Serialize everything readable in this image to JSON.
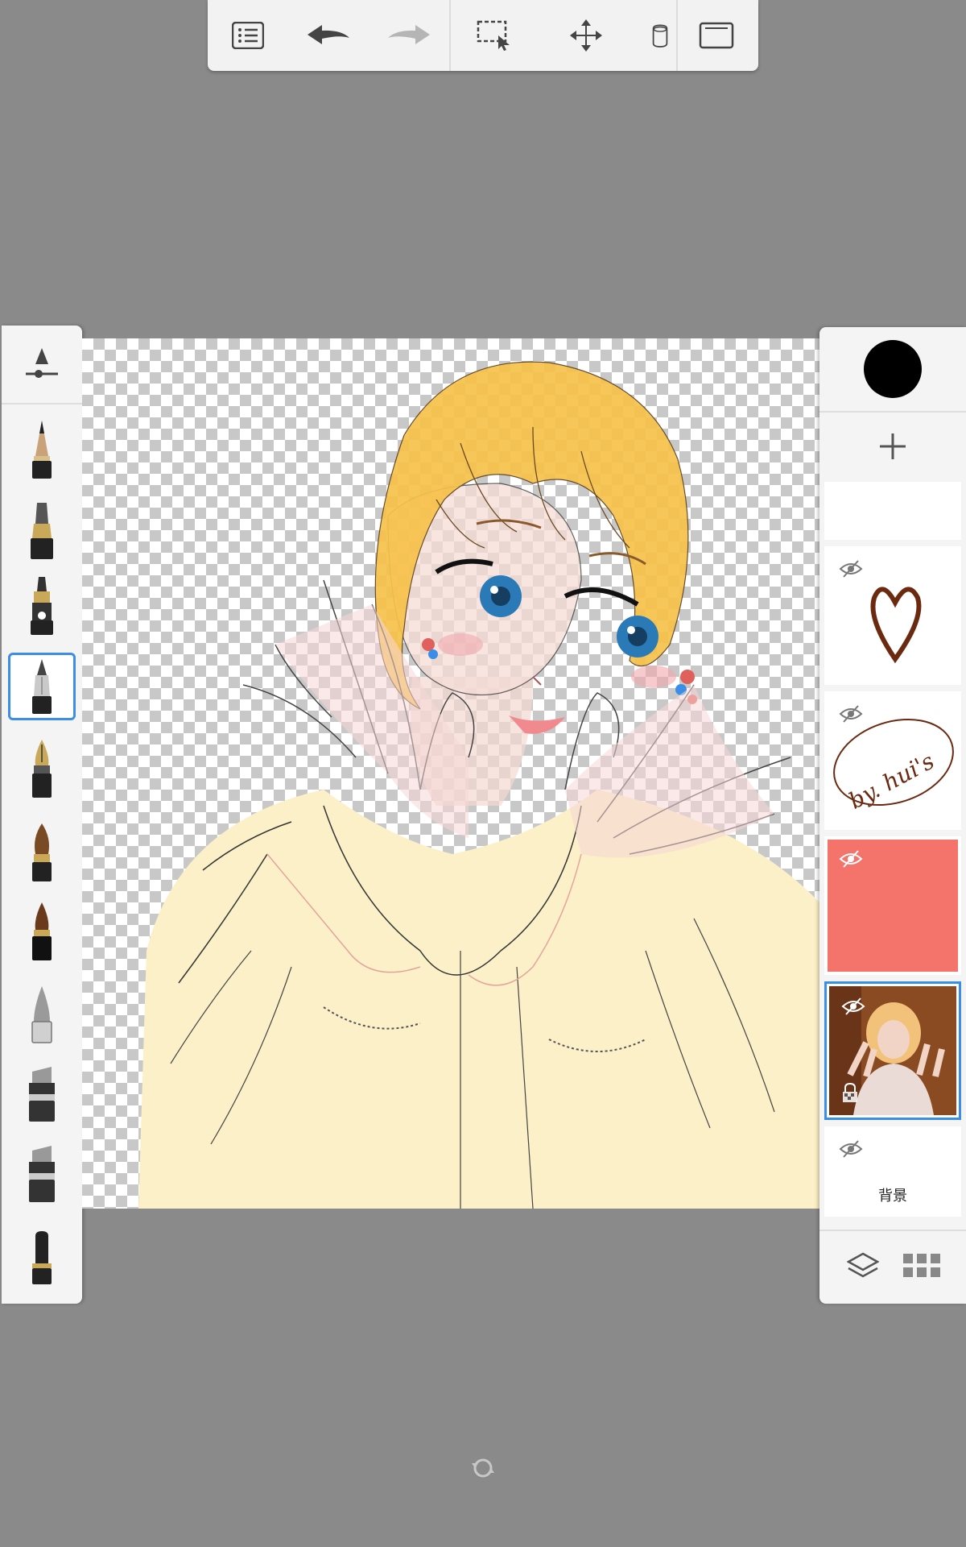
{
  "toolbar": {
    "buttons": [
      "menu",
      "undo",
      "redo",
      "selection",
      "transform",
      "fill",
      "fullscreen"
    ]
  },
  "brushes": {
    "settings_icon": "brush-settings-icon",
    "items": [
      "pencil",
      "ballpoint",
      "marker",
      "technical-pen",
      "fountain-pen",
      "paintbrush",
      "ink-brush",
      "airbrush",
      "chisel-marker",
      "wide-marker",
      "eraser"
    ],
    "selected": "technical-pen"
  },
  "colors": {
    "current": "#000000",
    "selection_accent": "#3b8ee8",
    "red_layer_fill": "#f4736b"
  },
  "layers": {
    "items": [
      {
        "id": "top-empty",
        "name": "",
        "visible": true
      },
      {
        "id": "heart",
        "name": "",
        "visible": true
      },
      {
        "id": "signature",
        "name": "",
        "visible": true,
        "signature_text": "by. hui's"
      },
      {
        "id": "red-fill",
        "name": "",
        "visible": true
      },
      {
        "id": "photo",
        "name": "",
        "visible": true,
        "locked": true,
        "selected": true
      },
      {
        "id": "background",
        "name": "背景",
        "visible": true
      }
    ]
  }
}
